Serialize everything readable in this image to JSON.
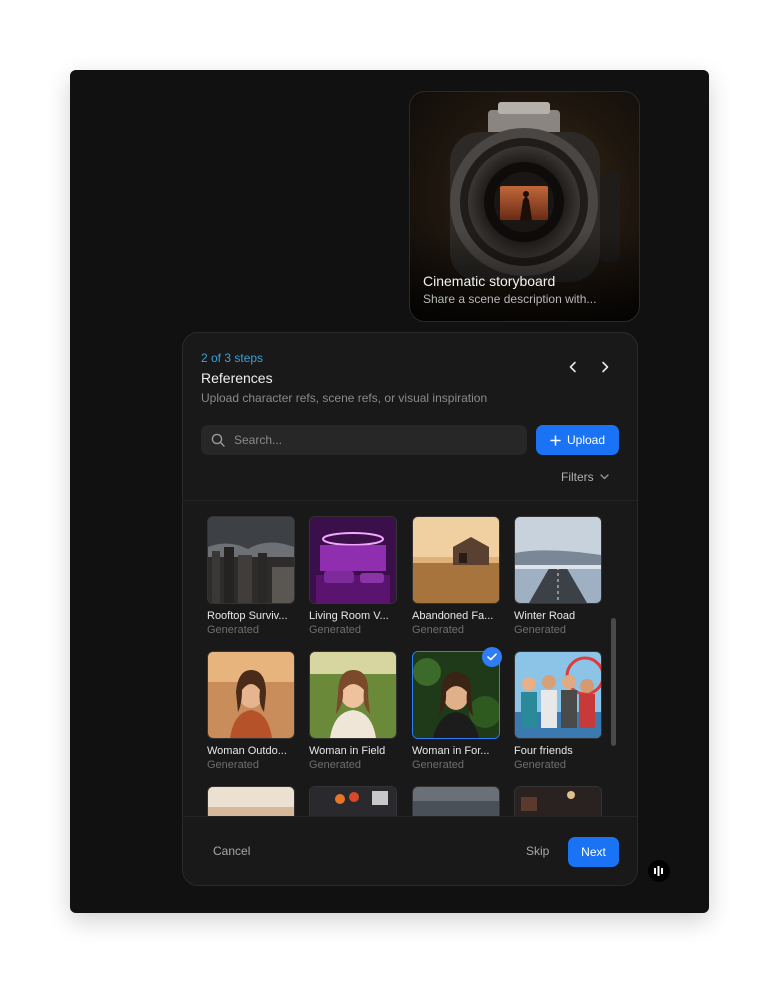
{
  "template_card": {
    "title": "Cinematic storyboard",
    "description": "Share a scene description with..."
  },
  "wizard": {
    "step_indicator": "2 of 3 steps",
    "title": "References",
    "subtitle": "Upload character refs, scene refs, or visual inspiration"
  },
  "search": {
    "placeholder": "Search..."
  },
  "toolbar": {
    "upload_label": "Upload",
    "filters_label": "Filters"
  },
  "references": [
    {
      "name": "Rooftop Surviv...",
      "source": "Generated",
      "selected": false
    },
    {
      "name": "Living Room V...",
      "source": "Generated",
      "selected": false
    },
    {
      "name": "Abandoned Fa...",
      "source": "Generated",
      "selected": false
    },
    {
      "name": "Winter Road",
      "source": "Generated",
      "selected": false
    },
    {
      "name": "Woman Outdo...",
      "source": "Generated",
      "selected": false
    },
    {
      "name": "Woman in Field",
      "source": "Generated",
      "selected": false
    },
    {
      "name": "Woman in For...",
      "source": "Generated",
      "selected": true
    },
    {
      "name": "Four friends",
      "source": "Generated",
      "selected": false
    }
  ],
  "footer": {
    "cancel_label": "Cancel",
    "skip_label": "Skip",
    "next_label": "Next"
  },
  "colors": {
    "accent": "#1a73f5",
    "step_text": "#3aa0d8",
    "panel": "#191919",
    "stage": "#111111"
  }
}
